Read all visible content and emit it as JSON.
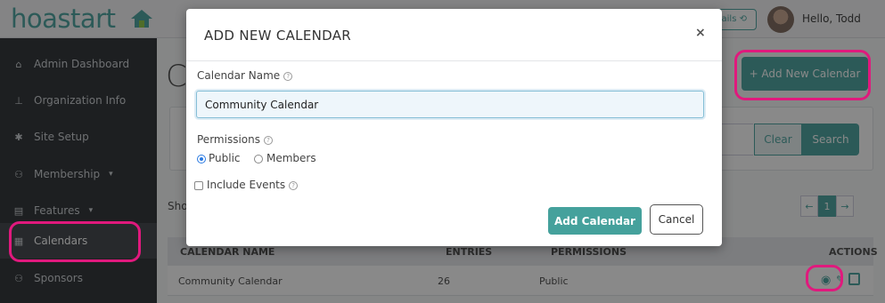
{
  "header": {
    "logo_text": "hoastart",
    "emails_button": "ails",
    "greeting": "Hello, Todd"
  },
  "sidebar": {
    "items": [
      {
        "label": "Admin Dashboard",
        "icon": "home-icon"
      },
      {
        "label": "Organization Info",
        "icon": "org-chart-icon"
      },
      {
        "label": "Site Setup",
        "icon": "gear-icon"
      },
      {
        "label": "Membership",
        "icon": "users-icon",
        "has_caret": true
      },
      {
        "label": "Features",
        "icon": "list-icon",
        "has_caret": true
      },
      {
        "label": "Calendars",
        "icon": "calendar-icon",
        "active": true
      },
      {
        "label": "Sponsors",
        "icon": "users-icon"
      }
    ]
  },
  "main": {
    "title_fragment": "C",
    "add_new_button": "+ Add New Calendar",
    "clear_button": "Clear",
    "search_button": "Search",
    "showing_fragment": "Sho",
    "pager": {
      "prev": "←",
      "current": "1",
      "next": "→"
    },
    "table": {
      "headers": [
        "CALENDAR NAME",
        "ENTRIES",
        "PERMISSIONS",
        "ACTIONS"
      ],
      "rows": [
        {
          "name": "Community Calendar",
          "entries": "26",
          "permissions": "Public"
        }
      ]
    }
  },
  "modal": {
    "title": "ADD NEW CALENDAR",
    "close_glyph": "×",
    "name_label": "Calendar Name",
    "name_value": "Community Calendar",
    "permissions_label": "Permissions",
    "permission_options": [
      "Public",
      "Members"
    ],
    "selected_permission": "Public",
    "include_events_label": "Include Events",
    "include_events_checked": false,
    "submit_button": "Add Calendar",
    "cancel_button": "Cancel"
  },
  "colors": {
    "brand": "#45a19c",
    "highlight": "#e0197d",
    "sidebar": "#262a2e"
  }
}
